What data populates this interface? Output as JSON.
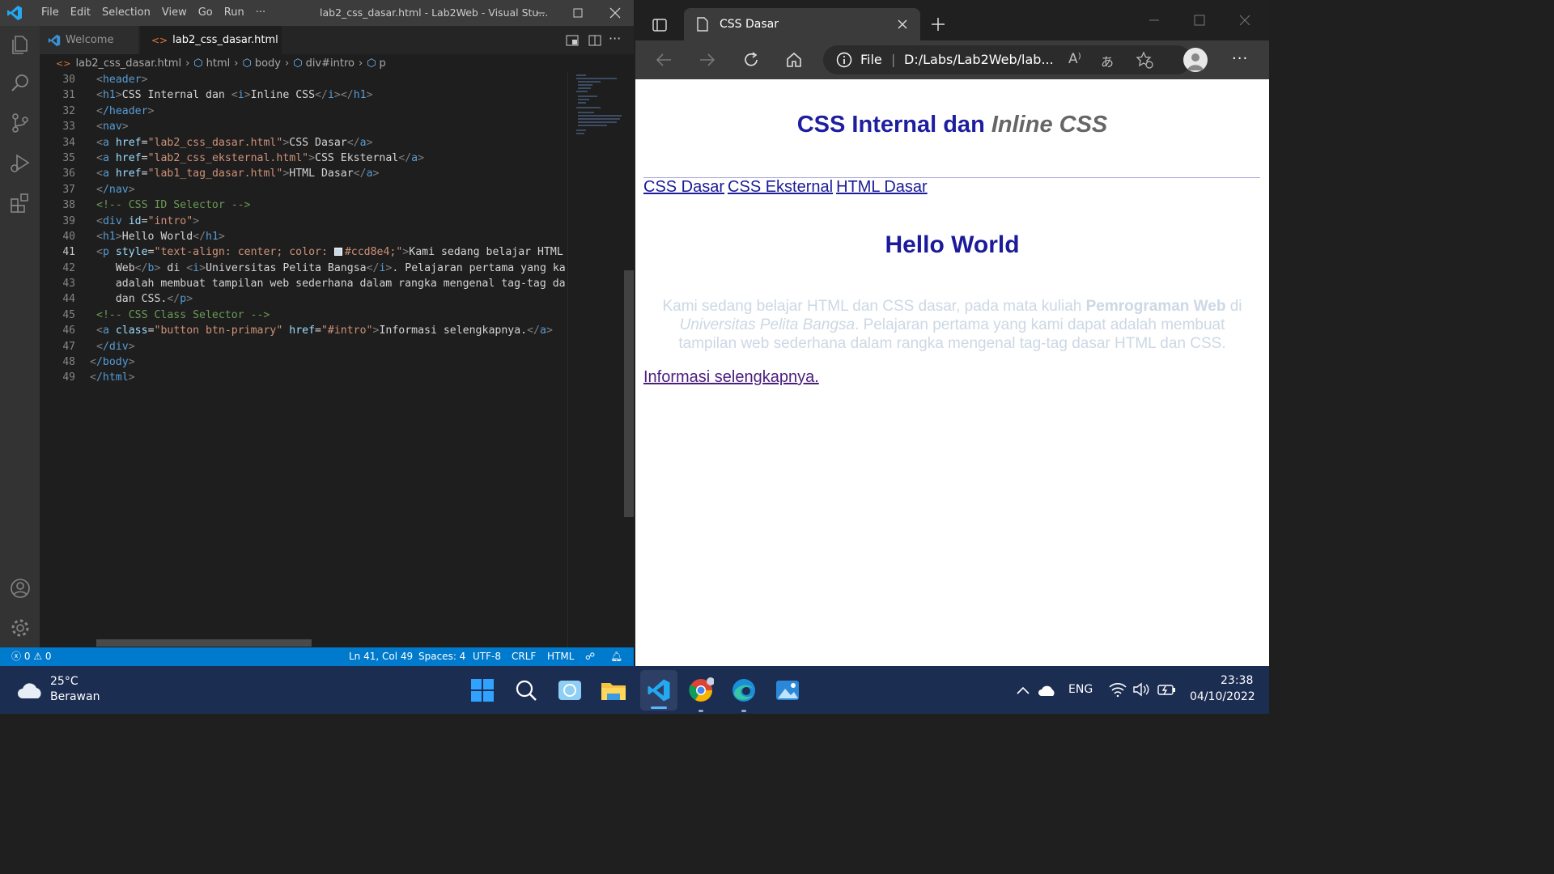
{
  "vscode": {
    "menu": [
      "File",
      "Edit",
      "Selection",
      "View",
      "Go",
      "Run",
      "···"
    ],
    "window_title": "lab2_css_dasar.html - Lab2Web - Visual Stu...",
    "tabs": [
      {
        "label": "Welcome"
      },
      {
        "label": "lab2_css_dasar.html"
      }
    ],
    "breadcrumb": [
      "lab2_css_dasar.html",
      "html",
      "body",
      "div#intro",
      "p"
    ],
    "line_numbers": [
      "30",
      "31",
      "32",
      "33",
      "34",
      "35",
      "36",
      "37",
      "38",
      "39",
      "40",
      "41",
      "42",
      "43",
      "44",
      "45",
      "46",
      "47",
      "48",
      "49"
    ],
    "code": {
      "l30_tag": "header",
      "l31_h1": "h1",
      "l31_text1": "CSS Internal dan ",
      "l31_i": "i",
      "l31_text2": "Inline CSS",
      "l32_tag": "/header",
      "l33_tag": "nav",
      "l34_href": "\"lab2_css_dasar.html\"",
      "l34_text": "CSS Dasar",
      "l35_href": "\"lab2_css_eksternal.html\"",
      "l35_text": "CSS Eksternal",
      "l36_href": "\"lab1_tag_dasar.html\"",
      "l36_text": "HTML Dasar",
      "l37_tag": "/nav",
      "l38_comment": "<!-- CSS ID Selector -->",
      "l39_val": "\"intro\"",
      "l40_text": "Hello World",
      "l41_style1": "\"text-align: center; color: ",
      "l41_style2": "#ccd8e4;\"",
      "l41_text": "Kami sedang belajar HTML",
      "l42_text1": "Web",
      "l42_text2": " di ",
      "l42_text3": "Universitas Pelita Bangsa",
      "l42_text4": ". Pelajaran pertama yang ka",
      "l43_text": "adalah membuat tampilan web sederhana dalam rangka mengenal tag-tag da",
      "l44_text": "dan CSS.",
      "l45_comment": "<!-- CSS Class Selector -->",
      "l46_class": "\"button btn-primary\"",
      "l46_href": "\"#intro\"",
      "l46_text": "Informasi selengkapnya.",
      "l47_tag": "/div",
      "l48_tag": "/body",
      "l49_tag": "/html"
    },
    "status": {
      "errors": "0",
      "warnings": "0",
      "position": "Ln 41, Col 49",
      "spaces": "Spaces: 4",
      "encoding": "UTF-8",
      "eol": "CRLF",
      "language": "HTML"
    }
  },
  "edge": {
    "tab_title": "CSS Dasar",
    "address_scheme": "File",
    "address_url": "D:/Labs/Lab2Web/lab...",
    "page": {
      "h1_text": "CSS Internal dan ",
      "h1_italic": "Inline CSS",
      "nav_links": [
        "CSS Dasar",
        "CSS Eksternal",
        "HTML Dasar"
      ],
      "h2": "Hello World",
      "paragraph_1": "Kami sedang belajar HTML dan CSS dasar, pada mata kuliah ",
      "paragraph_bold": "Pemrograman Web",
      "paragraph_2": " di ",
      "paragraph_italic": "Universitas Pelita Bangsa",
      "paragraph_3": ". Pelajaran pertama yang kami dapat adalah membuat tampilan web sederhana dalam rangka mengenal tag-tag dasar HTML dan CSS.",
      "paragraph_color": "#ccd8e4",
      "link": "Informasi selengkapnya."
    }
  },
  "taskbar": {
    "weather_temp": "25°C",
    "weather_desc": "Berawan",
    "language": "ENG",
    "time": "23:38",
    "date": "04/10/2022"
  },
  "colors": {
    "vscode_accent": "#007acc",
    "heading_blue": "#1b1b9a",
    "taskbar_bg": "#1c2d52"
  }
}
